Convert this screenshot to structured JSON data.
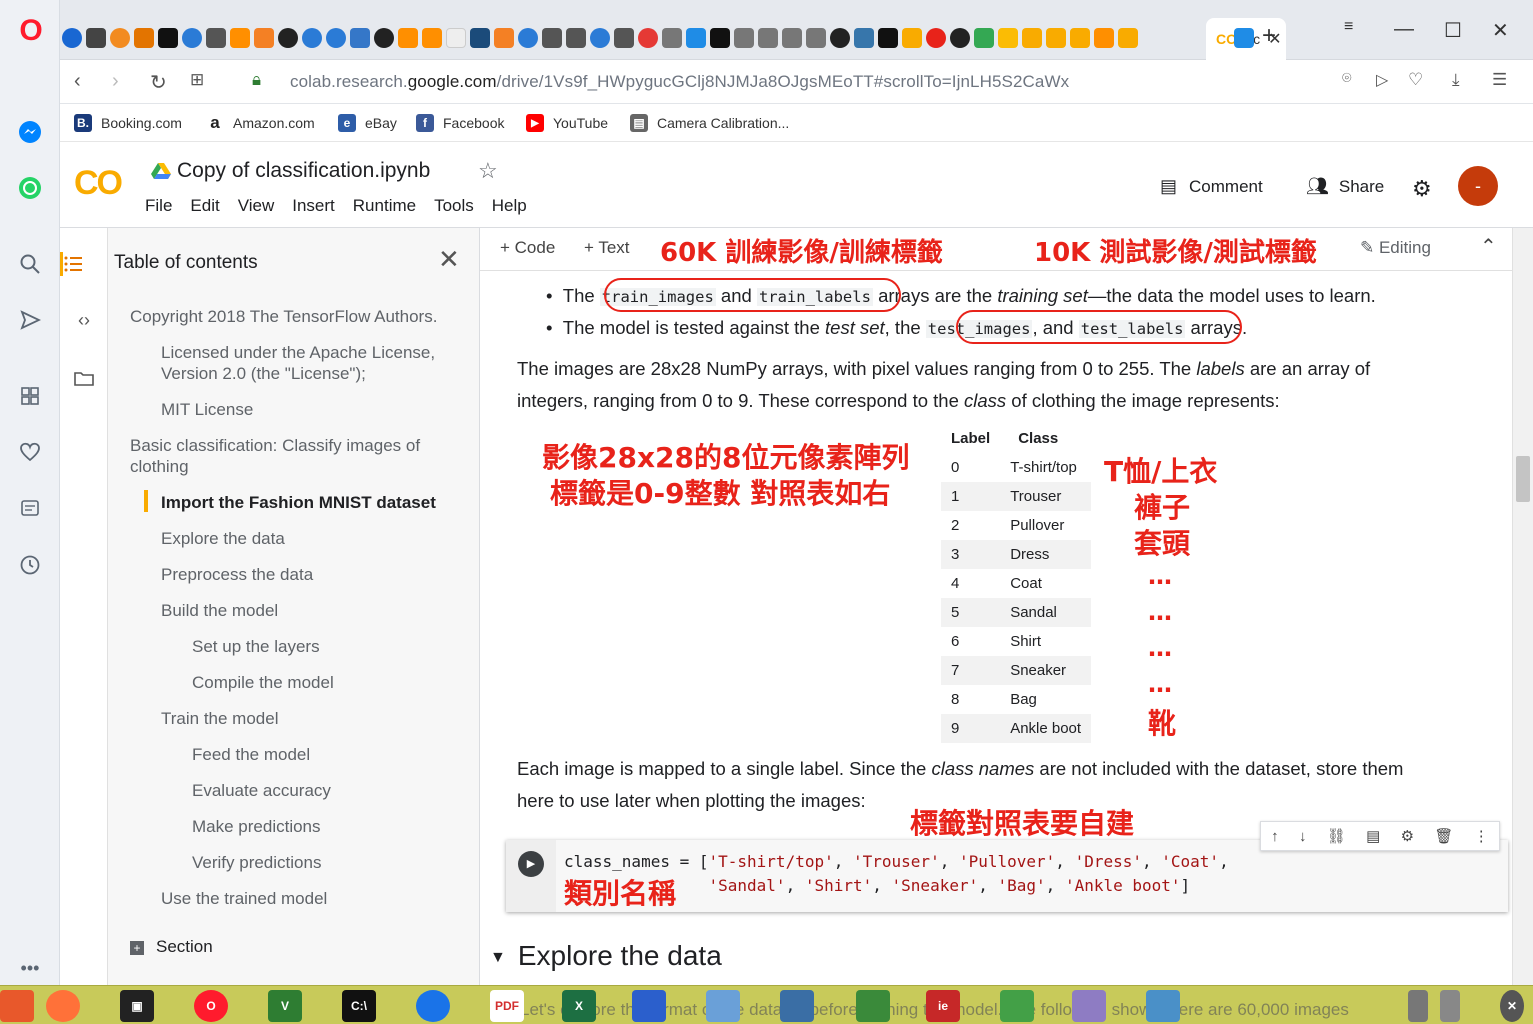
{
  "browser": {
    "active_tab_label": "Cc",
    "url_prefix": "colab.research.",
    "url_domain": "google.com",
    "url_path": "/drive/1Vs9f_HWpygucGClj8NJMJa8OJgsMEoTT#scrollTo=IjnLH5S2CaWx",
    "window_controls": {
      "minimize": "—",
      "maximize": "☐",
      "close": "✕"
    },
    "new_tab": "+"
  },
  "bookmarks": [
    {
      "label": "Booking.com",
      "icon": "B.",
      "color": "#1a3a7a"
    },
    {
      "label": "Amazon.com",
      "icon": "a",
      "color": "#222222"
    },
    {
      "label": "eBay",
      "icon": "e",
      "color": "#e53238"
    },
    {
      "label": "Facebook",
      "icon": "f",
      "color": "#3b5998"
    },
    {
      "label": "YouTube",
      "icon": "▶",
      "color": "#ff0000"
    },
    {
      "label": "Camera Calibration...",
      "icon": "▤",
      "color": "#555555"
    }
  ],
  "colab": {
    "logo": "CO",
    "title": "Copy of classification.ipynb",
    "menu": [
      "File",
      "Edit",
      "View",
      "Insert",
      "Runtime",
      "Tools",
      "Help"
    ],
    "comment": "Comment",
    "share": "Share",
    "avatar": "-"
  },
  "toc": {
    "title": "Table of contents",
    "items": [
      {
        "label": "Copyright 2018 The TensorFlow Authors."
      },
      {
        "label": "Licensed under the Apache License,"
      },
      {
        "label": "Version 2.0 (the \"License\");"
      },
      {
        "label": "MIT License"
      },
      {
        "label": "Basic classification: Classify images of"
      },
      {
        "label": "clothing"
      },
      {
        "label": "Import the Fashion MNIST dataset"
      },
      {
        "label": "Explore the data"
      },
      {
        "label": "Preprocess the data"
      },
      {
        "label": "Build the model"
      },
      {
        "label": "Set up the layers"
      },
      {
        "label": "Compile the model"
      },
      {
        "label": "Train the model"
      },
      {
        "label": "Feed the model"
      },
      {
        "label": "Evaluate accuracy"
      },
      {
        "label": "Make predictions"
      },
      {
        "label": "Verify predictions"
      },
      {
        "label": "Use the trained model"
      }
    ],
    "section": "Section"
  },
  "notebook_toolbar": {
    "code": "Code",
    "text": "Text",
    "editing": "Editing"
  },
  "annotations": {
    "train": "60K 訓練影像/訓練標籤",
    "test": "10K 測試影像/測試標籤",
    "pixels_line1": "影像28x28的8位元像素陣列",
    "pixels_line2": "標籤是0-9整數 對照表如右",
    "tshirt": "T恤/上衣",
    "trouser": "褲子",
    "pullover": "套頭",
    "dots": "…",
    "boot": "靴",
    "build_table": "標籤對照表要自建",
    "class_names": "類別名稱"
  },
  "content": {
    "bullet1_pre": "The",
    "bullet1_code1": "train_images",
    "bullet1_and": "and",
    "bullet1_code2": "train_labels",
    "bullet1_post": "arrays are the",
    "bullet1_em": "training set",
    "bullet1_tail": "—the data the model uses to learn.",
    "bullet2_pre": "The model is tested against the",
    "bullet2_em": "test set",
    "bullet2_mid": ", the",
    "bullet2_code1": "test_images",
    "bullet2_and": ", and",
    "bullet2_code2": "test_labels",
    "bullet2_tail": "arrays.",
    "para1_a": "The images are 28x28 NumPy arrays, with pixel values ranging from 0 to 255. The",
    "para1_em1": "labels",
    "para1_b": "are an array of",
    "para1_c": "integers, ranging from 0 to 9. These correspond to the",
    "para1_em2": "class",
    "para1_d": "of clothing the image represents:",
    "para2_a": "Each image is mapped to a single label. Since the",
    "para2_em": "class names",
    "para2_b": "are not included with the dataset, store them",
    "para2_c": "here to use later when plotting the images:",
    "heading": "Explore the data"
  },
  "table": {
    "headers": [
      "Label",
      "Class"
    ],
    "rows": [
      [
        "0",
        "T-shirt/top"
      ],
      [
        "1",
        "Trouser"
      ],
      [
        "2",
        "Pullover"
      ],
      [
        "3",
        "Dress"
      ],
      [
        "4",
        "Coat"
      ],
      [
        "5",
        "Sandal"
      ],
      [
        "6",
        "Shirt"
      ],
      [
        "7",
        "Sneaker"
      ],
      [
        "8",
        "Bag"
      ],
      [
        "9",
        "Ankle boot"
      ]
    ]
  },
  "code_cell": {
    "var": "class_names",
    "line1_strings": [
      "'T-shirt/top'",
      "'Trouser'",
      "'Pullover'",
      "'Dress'",
      "'Coat'"
    ],
    "line2_strings": [
      "'Sandal'",
      "'Shirt'",
      "'Sneaker'",
      "'Bag'",
      "'Ankle boot'"
    ]
  },
  "taskbar_overlay": "Let's explore the format of the dataset before training the model. The following shows there are 60,000 images"
}
